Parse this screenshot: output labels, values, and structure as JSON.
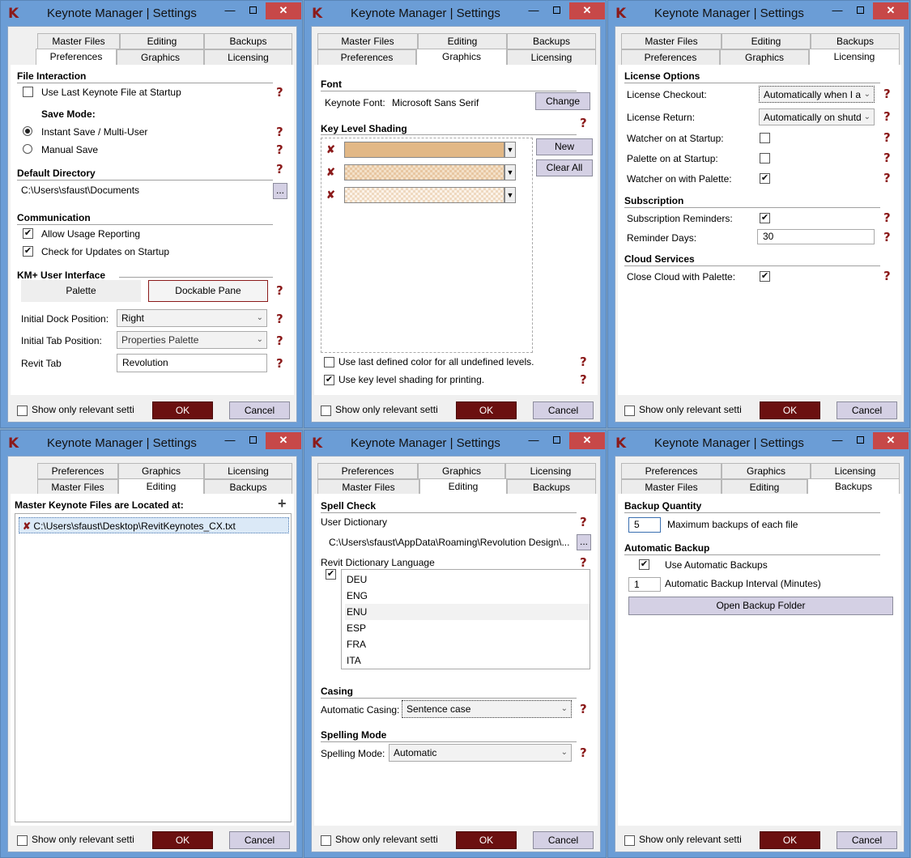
{
  "app": {
    "logo": "K",
    "title": "Keynote Manager | Settings"
  },
  "tab_labels": {
    "preferences": "Preferences",
    "graphics": "Graphics",
    "licensing": "Licensing",
    "master_files": "Master Files",
    "editing": "Editing",
    "backups": "Backups"
  },
  "footer": {
    "show_relevant": "Show only relevant setti",
    "ok": "OK",
    "cancel": "Cancel"
  },
  "help": "?",
  "preferences": {
    "file_interaction": "File Interaction",
    "use_last": "Use Last Keynote File at Startup",
    "save_mode": "Save Mode:",
    "instant_save": "Instant Save / Multi-User",
    "manual_save": "Manual Save",
    "default_directory": "Default Directory",
    "directory_value": "C:\\Users\\sfaust\\Documents",
    "browse": "...",
    "communication": "Communication",
    "allow_usage": "Allow Usage Reporting",
    "check_updates": "Check for Updates on Startup",
    "km_ui": "KM+ User Interface",
    "palette": "Palette",
    "dockable": "Dockable Pane",
    "dock_label": "Initial Dock Position:",
    "dock_value": "Right",
    "tab_label": "Initial Tab Position:",
    "tab_value": "Properties Palette",
    "revit_tab_label": "Revit Tab",
    "revit_tab_value": "Revolution"
  },
  "graphics": {
    "font_header": "Font",
    "font_label": "Keynote Font:",
    "font_value": "Microsoft Sans Serif",
    "change": "Change",
    "shading_header": "Key Level Shading",
    "new": "New",
    "clear_all": "Clear All",
    "use_last_color": "Use last defined color for all undefined levels.",
    "use_printing": "Use key level shading for printing.",
    "swatch_color": "#e2b886"
  },
  "licensing": {
    "license_options": "License Options",
    "checkout_label": "License Checkout:",
    "checkout_value": "Automatically when I a",
    "return_label": "License Return:",
    "return_value": "Automatically on shutd",
    "watcher_startup": "Watcher on at Startup:",
    "palette_startup": "Palette on at Startup:",
    "watcher_palette": "Watcher on with Palette:",
    "subscription": "Subscription",
    "sub_reminders": "Subscription Reminders:",
    "reminder_days": "Reminder Days:",
    "reminder_days_value": "30",
    "cloud": "Cloud Services",
    "close_cloud": "Close Cloud with Palette:"
  },
  "master_files": {
    "header": "Master Keynote Files are Located at:",
    "add": "+",
    "file_path": "C:\\Users\\sfaust\\Desktop\\RevitKeynotes_CX.txt"
  },
  "editing": {
    "spell_check": "Spell Check",
    "user_dictionary": "User Dictionary",
    "dictionary_path": "C:\\Users\\sfaust\\AppData\\Roaming\\Revolution Design\\...",
    "browse": "...",
    "revit_language": "Revit Dictionary Language",
    "languages": [
      "DEU",
      "ENG",
      "ENU",
      "ESP",
      "FRA",
      "ITA"
    ],
    "casing": "Casing",
    "casing_label": "Automatic Casing:",
    "casing_value": "Sentence case",
    "spelling_mode": "Spelling Mode",
    "spelling_label": "Spelling Mode:",
    "spelling_value": "Automatic"
  },
  "backups": {
    "quantity_header": "Backup Quantity",
    "max_value": "5",
    "max_label": "Maximum backups of each file",
    "auto_header": "Automatic Backup",
    "use_auto": "Use Automatic Backups",
    "interval_value": "1",
    "interval_label": "Automatic Backup Interval (Minutes)",
    "open_folder": "Open Backup Folder"
  }
}
